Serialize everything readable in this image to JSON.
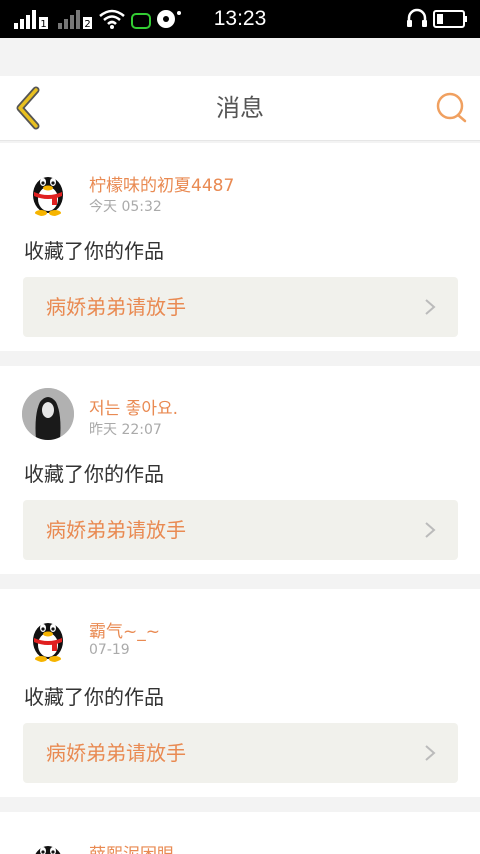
{
  "statusbar": {
    "time": "13:23",
    "sim1": "1",
    "sim2": "2"
  },
  "header": {
    "title": "消息",
    "back_icon": "chevron-left-icon",
    "search_icon": "search-icon"
  },
  "colors": {
    "accent": "#e98a52",
    "back": "#e8c020",
    "search": "#f0a060",
    "background": "#f3f3f3",
    "work_box": "#f1f1ec"
  },
  "messages": [
    {
      "name": "柠檬味的初夏4487",
      "time": "今天 05:32",
      "action": "收藏了你的作品",
      "work": "病娇弟弟请放手",
      "avatar": "penguin-avatar"
    },
    {
      "name": "저는 좋아요.",
      "time": "昨天 22:07",
      "action": "收藏了你的作品",
      "work": "病娇弟弟请放手",
      "avatar": "photo-avatar"
    },
    {
      "name": "霸气~_~",
      "time": "07-19",
      "action": "收藏了你的作品",
      "work": "病娇弟弟请放手",
      "avatar": "penguin-avatar"
    },
    {
      "name": "薛熙泥困眼",
      "time": "",
      "action": "",
      "work": "",
      "avatar": "penguin-avatar"
    }
  ]
}
